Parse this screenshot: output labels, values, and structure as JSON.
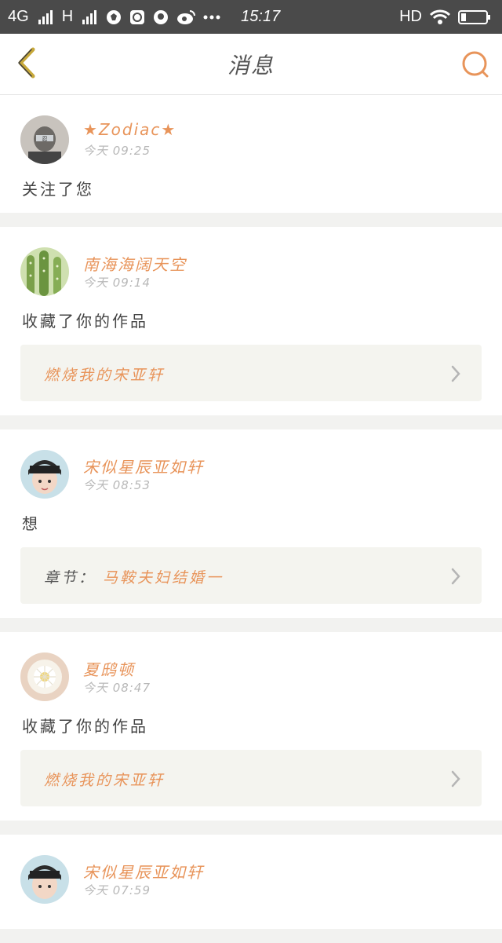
{
  "status_bar": {
    "network_left": "4G",
    "network_right": "H",
    "time": "15:17",
    "hd": "HD"
  },
  "nav": {
    "title": "消息"
  },
  "messages": [
    {
      "user": "★Zodiac★",
      "time": "今天 09:25",
      "action": "关注了您",
      "avatar": "avatar-ninja"
    },
    {
      "user": "南海海阔天空",
      "time": "今天 09:14",
      "action": "收藏了你的作品",
      "link_prefix": "",
      "link_title": "燃烧我的宋亚轩",
      "avatar": "avatar-cactus"
    },
    {
      "user": "宋似星辰亚如轩",
      "time": "今天 08:53",
      "action": "想",
      "link_prefix": "章节：",
      "link_title": "马鞍夫妇结婚一",
      "avatar": "avatar-boy"
    },
    {
      "user": "夏鸱顿",
      "time": "今天 08:47",
      "action": "收藏了你的作品",
      "link_prefix": "",
      "link_title": "燃烧我的宋亚轩",
      "avatar": "avatar-flower"
    },
    {
      "user": "宋似星辰亚如轩",
      "time": "今天 07:59",
      "avatar": "avatar-boy"
    }
  ],
  "colors": {
    "accent": "#e8945a",
    "back_icon": "#c7a83a"
  }
}
